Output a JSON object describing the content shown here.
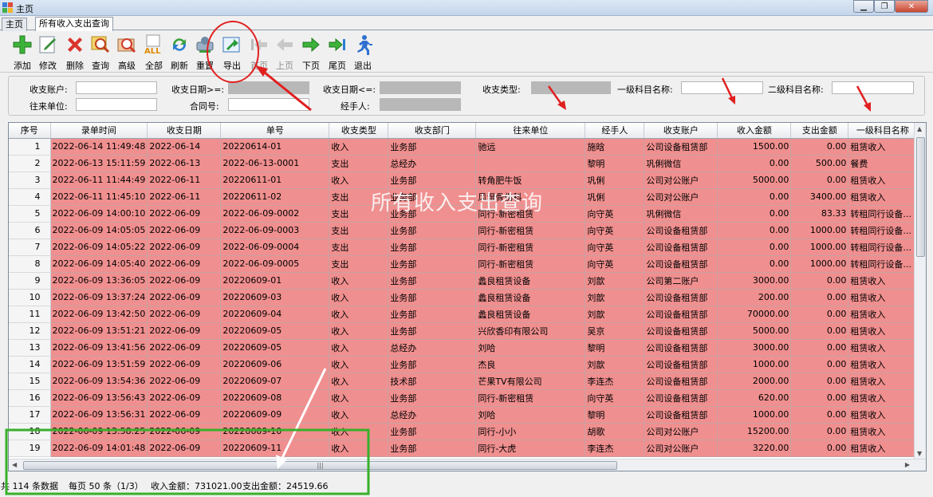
{
  "window": {
    "title": "主页"
  },
  "tabs": [
    {
      "label": "主页",
      "active": false
    },
    {
      "label": "所有收入支出查询",
      "active": true
    }
  ],
  "toolbar": [
    {
      "name": "add",
      "label": "添加",
      "icon": "plus-icon",
      "enabled": true
    },
    {
      "name": "edit",
      "label": "修改",
      "icon": "edit-icon",
      "enabled": true
    },
    {
      "name": "delete",
      "label": "删除",
      "icon": "delete-x-icon",
      "enabled": true
    },
    {
      "name": "query",
      "label": "查询",
      "icon": "search-icon",
      "enabled": true
    },
    {
      "name": "advanced",
      "label": "高级",
      "icon": "advanced-search-icon",
      "enabled": true
    },
    {
      "name": "all",
      "label": "全部",
      "icon": "all-icon",
      "enabled": true
    },
    {
      "name": "refresh",
      "label": "刷新",
      "icon": "refresh-icon",
      "enabled": true
    },
    {
      "name": "reset",
      "label": "重置",
      "icon": "reset-icon",
      "enabled": true
    },
    {
      "name": "export",
      "label": "导出",
      "icon": "export-icon",
      "enabled": true
    },
    {
      "name": "first-page",
      "label": "首页",
      "icon": "first-page-icon",
      "enabled": false
    },
    {
      "name": "prev-page",
      "label": "上页",
      "icon": "prev-page-icon",
      "enabled": false
    },
    {
      "name": "next-page",
      "label": "下页",
      "icon": "next-page-icon",
      "enabled": true
    },
    {
      "name": "last-page",
      "label": "尾页",
      "icon": "last-page-icon",
      "enabled": true
    },
    {
      "name": "exit",
      "label": "退出",
      "icon": "exit-runner-icon",
      "enabled": true
    }
  ],
  "filters": {
    "account": {
      "label": "收支账户:",
      "value": ""
    },
    "date_from": {
      "label": "收支日期>=:",
      "value": ""
    },
    "date_to": {
      "label": "收支日期<=:",
      "value": ""
    },
    "type": {
      "label": "收支类型:",
      "value": ""
    },
    "subject1": {
      "label": "一级科目名称:",
      "value": ""
    },
    "subject2": {
      "label": "二级科目名称:",
      "value": ""
    },
    "partner": {
      "label": "往来单位:",
      "value": ""
    },
    "contract": {
      "label": "合同号:",
      "value": ""
    },
    "handler": {
      "label": "经手人:",
      "value": ""
    }
  },
  "grid": {
    "columns": [
      "序号",
      "录单时间",
      "收支日期",
      "单号",
      "收支类型",
      "收支部门",
      "往来单位",
      "经手人",
      "收支账户",
      "收入金额",
      "支出金额",
      "一级科目名称"
    ],
    "rows": [
      [
        "1",
        "2022-06-14 11:49:48",
        "2022-06-14",
        "20220614-01",
        "收入",
        "业务部",
        "驰远",
        "施晗",
        "公司设备租赁部",
        "1500.00",
        "0.00",
        "租赁收入"
      ],
      [
        "2",
        "2022-06-13 15:11:59",
        "2022-06-13",
        "2022-06-13-0001",
        "支出",
        "总经办",
        "",
        "黎明",
        "巩俐微信",
        "0.00",
        "500.00",
        "餐费"
      ],
      [
        "3",
        "2022-06-11 11:44:49",
        "2022-06-11",
        "20220611-01",
        "收入",
        "业务部",
        "转角肥牛饭",
        "巩俐",
        "公司对公账户",
        "5000.00",
        "0.00",
        "租赁收入"
      ],
      [
        "4",
        "2022-06-11 11:45:10",
        "2022-06-11",
        "20220611-02",
        "支出",
        "业务部",
        "风湿骨伤科",
        "巩俐",
        "公司对公账户",
        "0.00",
        "3400.00",
        "租赁收入"
      ],
      [
        "5",
        "2022-06-09 14:00:10",
        "2022-06-09",
        "2022-06-09-0002",
        "支出",
        "业务部",
        "同行-新密租赁",
        "向守英",
        "巩俐微信",
        "0.00",
        "83.33",
        "转租同行设备..."
      ],
      [
        "6",
        "2022-06-09 14:05:05",
        "2022-06-09",
        "2022-06-09-0003",
        "支出",
        "业务部",
        "同行-新密租赁",
        "向守英",
        "公司设备租赁部",
        "0.00",
        "1000.00",
        "转租同行设备..."
      ],
      [
        "7",
        "2022-06-09 14:05:22",
        "2022-06-09",
        "2022-06-09-0004",
        "支出",
        "业务部",
        "同行-新密租赁",
        "向守英",
        "公司设备租赁部",
        "0.00",
        "1000.00",
        "转租同行设备..."
      ],
      [
        "8",
        "2022-06-09 14:05:40",
        "2022-06-09",
        "2022-06-09-0005",
        "支出",
        "业务部",
        "同行-新密租赁",
        "向守英",
        "公司设备租赁部",
        "0.00",
        "1000.00",
        "转租同行设备..."
      ],
      [
        "9",
        "2022-06-09 13:36:05",
        "2022-06-09",
        "20220609-01",
        "收入",
        "业务部",
        "蠡良租赁设备",
        "刘歆",
        "公司第二账户",
        "3000.00",
        "0.00",
        "租赁收入"
      ],
      [
        "10",
        "2022-06-09 13:37:24",
        "2022-06-09",
        "20220609-03",
        "收入",
        "业务部",
        "蠡良租赁设备",
        "刘歆",
        "公司设备租赁部",
        "200.00",
        "0.00",
        "租赁收入"
      ],
      [
        "11",
        "2022-06-09 13:42:50",
        "2022-06-09",
        "20220609-04",
        "收入",
        "业务部",
        "蠡良租赁设备",
        "刘歆",
        "公司设备租赁部",
        "70000.00",
        "0.00",
        "租赁收入"
      ],
      [
        "12",
        "2022-06-09 13:51:21",
        "2022-06-09",
        "20220609-05",
        "收入",
        "业务部",
        "兴欣香印有限公司",
        "吴京",
        "公司设备租赁部",
        "5000.00",
        "0.00",
        "租赁收入"
      ],
      [
        "13",
        "2022-06-09 13:41:56",
        "2022-06-09",
        "20220609-05",
        "收入",
        "总经办",
        "刘哈",
        "黎明",
        "公司设备租赁部",
        "3000.00",
        "0.00",
        "租赁收入"
      ],
      [
        "14",
        "2022-06-09 13:51:59",
        "2022-06-09",
        "20220609-06",
        "收入",
        "业务部",
        "杰良",
        "刘歆",
        "公司设备租赁部",
        "1000.00",
        "0.00",
        "租赁收入"
      ],
      [
        "15",
        "2022-06-09 13:54:36",
        "2022-06-09",
        "20220609-07",
        "收入",
        "技术部",
        "芒果TV有限公司",
        "李连杰",
        "公司设备租赁部",
        "2000.00",
        "0.00",
        "租赁收入"
      ],
      [
        "16",
        "2022-06-09 13:56:43",
        "2022-06-09",
        "20220609-08",
        "收入",
        "业务部",
        "同行-新密租赁",
        "向守英",
        "公司设备租赁部",
        "620.00",
        "0.00",
        "租赁收入"
      ],
      [
        "17",
        "2022-06-09 13:56:31",
        "2022-06-09",
        "20220609-09",
        "收入",
        "总经办",
        "刘哈",
        "黎明",
        "公司设备租赁部",
        "1000.00",
        "0.00",
        "租赁收入"
      ],
      [
        "18",
        "2022-06-09 13:58:25",
        "2022-06-09",
        "20220609-10",
        "收入",
        "业务部",
        "同行-小小",
        "胡歌",
        "公司对公账户",
        "15200.00",
        "0.00",
        "租赁收入"
      ],
      [
        "19",
        "2022-06-09 14:01:48",
        "2022-06-09",
        "20220609-11",
        "收入",
        "业务部",
        "同行-大虎",
        "李连杰",
        "公司对公账户",
        "3220.00",
        "0.00",
        "租赁收入"
      ]
    ]
  },
  "watermark": "所有收入支出查询",
  "status": {
    "total": "共 114 条数据",
    "paging": "每页 50 条（1/3）",
    "income": "收入金额：731021.00",
    "expense": "支出金额：24519.66"
  },
  "colors": {
    "row_bg": "#f08f8f",
    "annotation_red": "#e02020",
    "annotation_green": "#38b02a"
  }
}
